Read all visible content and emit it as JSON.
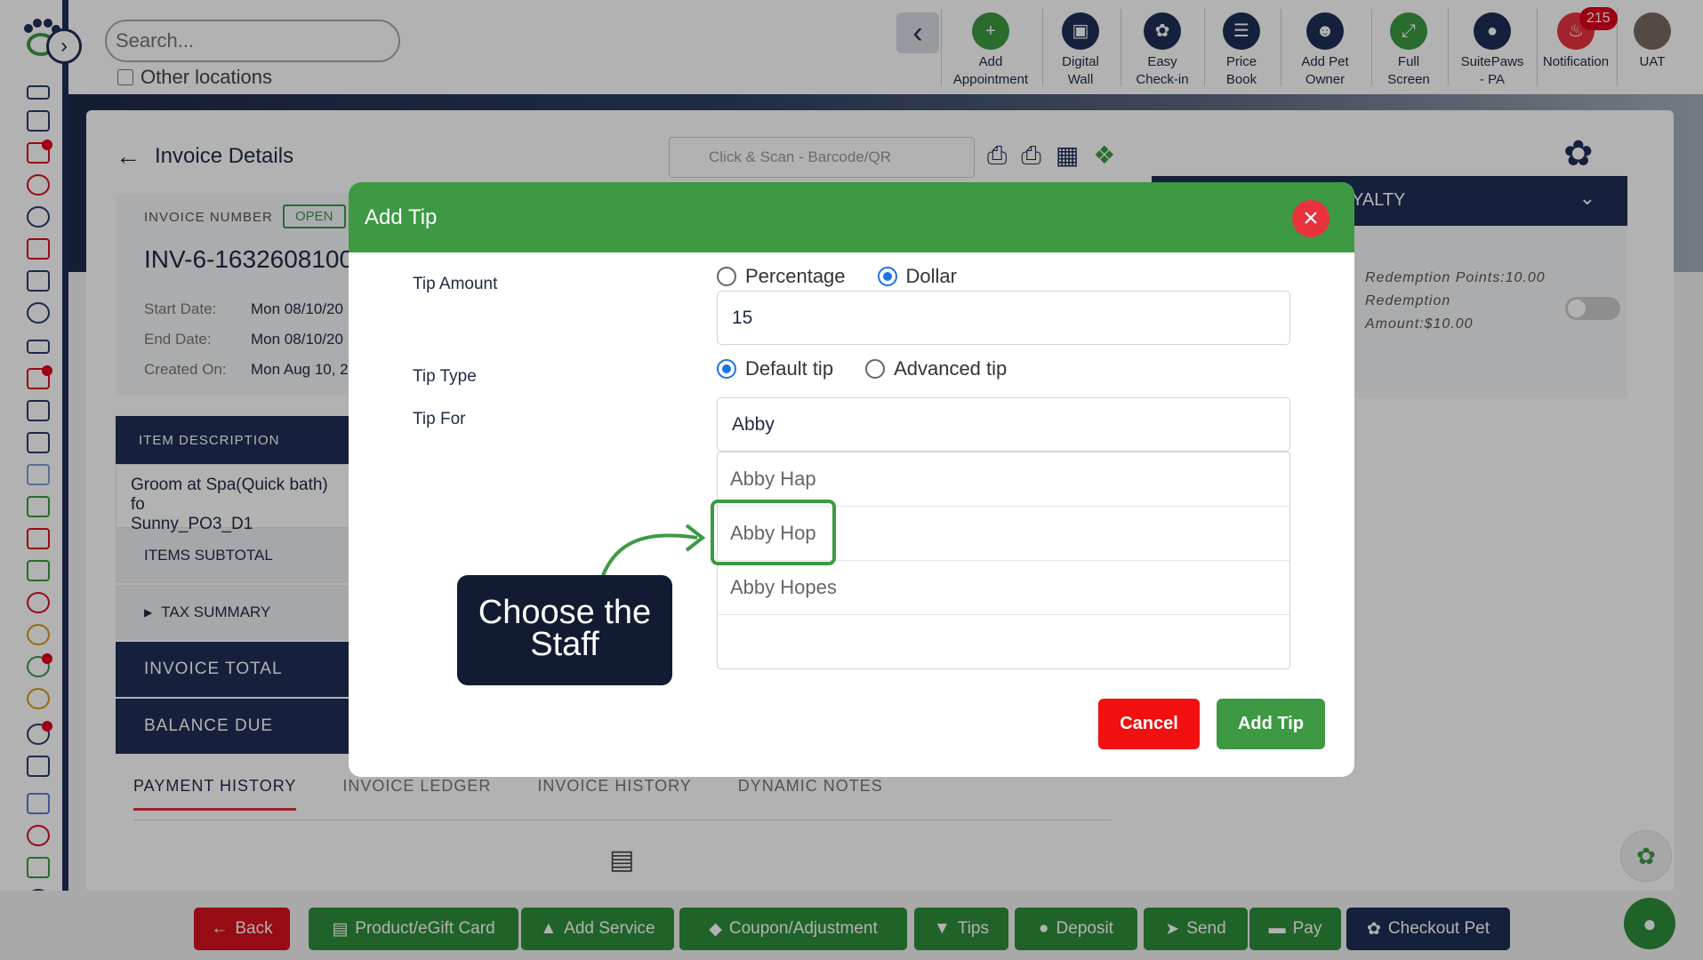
{
  "search": {
    "placeholder": "Search...",
    "other_locations": "Other locations"
  },
  "toolbar": {
    "items": [
      {
        "label": "Add\nAppointment",
        "line1": "Add",
        "line2": "Appointment"
      },
      {
        "line1": "Digital",
        "line2": "Wall"
      },
      {
        "line1": "Easy",
        "line2": "Check-in"
      },
      {
        "line1": "Price",
        "line2": "Book"
      },
      {
        "line1": "Add Pet",
        "line2": "Owner"
      },
      {
        "line1": "Full",
        "line2": "Screen"
      },
      {
        "line1": "SuitePaws",
        "line2": "- PA"
      },
      {
        "line1": "Notification",
        "line2": ""
      },
      {
        "line1": "UAT",
        "line2": ""
      }
    ],
    "notification_count": "215"
  },
  "page": {
    "title": "Invoice Details",
    "scan_placeholder": "Click & Scan - Barcode/QR",
    "invoice_label": "INVOICE NUMBER",
    "status": "OPEN",
    "invoice_number": "INV-6-1632608100",
    "start_label": "Start Date:",
    "start_value": "Mon 08/10/20",
    "end_label": "End Date:",
    "end_value": "Mon 08/10/20",
    "created_label": "Created On:",
    "created_value": "Mon Aug 10, 2",
    "loyalty": "YALTY",
    "redemption_points": "Redemption Points:10.00",
    "redemption_amount": "Redemption Amount:$10.00"
  },
  "table": {
    "item_description": "ITEM DESCRIPTION",
    "item_line1": "Groom at Spa(Quick bath) fo",
    "item_line2": "Sunny_PO3_D1",
    "items_subtotal": "ITEMS SUBTOTAL",
    "tax_summary": "TAX SUMMARY",
    "invoice_total": "INVOICE TOTAL",
    "balance_due": "BALANCE DUE"
  },
  "tabs": [
    "PAYMENT HISTORY",
    "INVOICE LEDGER",
    "INVOICE HISTORY",
    "DYNAMIC NOTES"
  ],
  "bottom": {
    "back": "Back",
    "product": "Product/eGift Card",
    "service": "Add Service",
    "coupon": "Coupon/Adjustment",
    "tips": "Tips",
    "deposit": "Deposit",
    "send": "Send",
    "pay": "Pay",
    "checkout": "Checkout Pet"
  },
  "modal": {
    "title": "Add Tip",
    "tip_amount_label": "Tip Amount",
    "percentage": "Percentage",
    "dollar": "Dollar",
    "amount_value": "15",
    "tip_type_label": "Tip Type",
    "default_tip": "Default tip",
    "advanced_tip": "Advanced tip",
    "tip_for_label": "Tip For",
    "tip_for_value": "Abby",
    "options": [
      "Abby Hap",
      "Abby Hop",
      "Abby Hopes"
    ],
    "cancel": "Cancel",
    "add_tip": "Add Tip",
    "tooltip": "Choose the Staff"
  },
  "colors": {
    "navy": "#1f2f57",
    "green": "#3d9a43",
    "red": "#d8101d"
  }
}
